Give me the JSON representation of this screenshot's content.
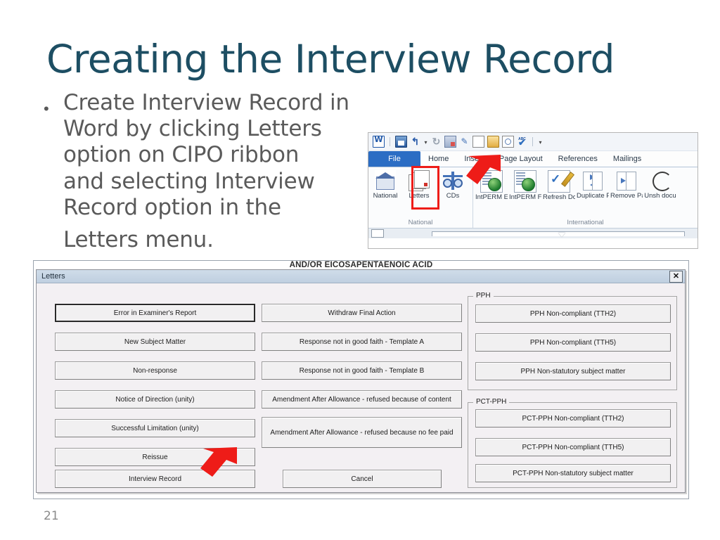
{
  "slide": {
    "title": "Creating the Interview Record",
    "number": "21",
    "bullet": {
      "marker": "•",
      "lines": [
        "Create Interview Record in Word by clicking Letters",
        "option on CIPO ribbon",
        "and selecting Interview",
        "Record option in the",
        "Letters menu."
      ]
    }
  },
  "ribbon_screenshot": {
    "quick_access": [
      {
        "name": "word-logo-icon",
        "label": "W"
      },
      {
        "name": "save-icon",
        "label": "Save"
      },
      {
        "name": "undo-icon",
        "label": "Undo"
      },
      {
        "name": "undo-dropdown-icon",
        "label": "▾"
      },
      {
        "name": "redo-icon",
        "label": "Redo"
      },
      {
        "name": "insert-image-icon",
        "label": "Insert Image"
      },
      {
        "name": "format-painter-icon",
        "label": "Format Painter"
      },
      {
        "name": "new-document-icon",
        "label": "New"
      },
      {
        "name": "open-folder-icon",
        "label": "Open"
      },
      {
        "name": "print-preview-icon",
        "label": "Print Preview"
      },
      {
        "name": "spelling-check-icon",
        "label": "Spelling"
      },
      {
        "name": "customize-qat-icon",
        "label": "▾"
      }
    ],
    "tabs": [
      {
        "label": "File",
        "active": true
      },
      {
        "label": "Home",
        "active": false
      },
      {
        "label": "Insert",
        "active": false
      },
      {
        "label": "Page Layout",
        "active": false
      },
      {
        "label": "References",
        "active": false
      },
      {
        "label": "Mailings",
        "active": false
      }
    ],
    "groups": [
      {
        "label": "National",
        "items": [
          {
            "label": "National",
            "icon": "house-icon",
            "highlighted": false
          },
          {
            "label": "Letters",
            "icon": "stacked-documents-icon",
            "highlighted": true
          },
          {
            "label": "CDs",
            "icon": "balance-scale-icon",
            "highlighted": false
          }
        ]
      },
      {
        "label": "International",
        "items": [
          {
            "label": "IntPERM Eng",
            "icon": "globe-document-icon",
            "highlighted": false
          },
          {
            "label": "IntPERM Fre",
            "icon": "globe-document-icon",
            "highlighted": false
          },
          {
            "label": "Refresh Document",
            "icon": "checkmark-pencil-icon",
            "highlighted": false
          },
          {
            "label": "Duplicate Page",
            "icon": "duplicate-page-icon",
            "highlighted": false
          },
          {
            "label": "Remove Page",
            "icon": "remove-page-icon",
            "highlighted": false
          },
          {
            "label": "Unsh docu",
            "icon": "unshare-document-icon",
            "highlighted": false
          }
        ]
      }
    ],
    "highlight_color": "#ee1c18",
    "arrow_color": "#ee1c18"
  },
  "document_background": {
    "text": "AND/OR EICOSAPENTAENOIC ACID"
  },
  "letters_dialog": {
    "title": "Letters",
    "close_label": "✕",
    "left_column": [
      {
        "label": "Error in Examiner's Report",
        "focused": true
      },
      {
        "label": "New Subject Matter",
        "focused": false
      },
      {
        "label": "Non-response",
        "focused": false
      },
      {
        "label": "Notice of Direction (unity)",
        "focused": false
      },
      {
        "label": "Successful Limitation (unity)",
        "focused": false
      },
      {
        "label": "Reissue",
        "focused": false
      },
      {
        "label": "Interview Record",
        "focused": false
      }
    ],
    "middle_column": [
      {
        "label": "Withdraw Final Action"
      },
      {
        "label": "Response not in good faith - Template A"
      },
      {
        "label": "Response not in good faith - Template B"
      },
      {
        "label": "Amendment After Allowance - refused because of content"
      },
      {
        "label": "Amendment After Allowance - refused because no fee paid"
      }
    ],
    "cancel_label": "Cancel",
    "groups": [
      {
        "legend": "PPH",
        "buttons": [
          {
            "label": "PPH Non-compliant (TTH2)"
          },
          {
            "label": "PPH Non-compliant (TTH5)"
          },
          {
            "label": "PPH Non-statutory subject matter"
          }
        ]
      },
      {
        "legend": "PCT-PPH",
        "buttons": [
          {
            "label": "PCT-PPH Non-compliant (TTH2)"
          },
          {
            "label": "PCT-PPH Non-compliant (TTH5)"
          },
          {
            "label": "PCT-PPH Non-statutory subject matter"
          }
        ]
      }
    ],
    "arrow_color": "#ee1c18"
  },
  "colors": {
    "title": "#1d4e63",
    "body_text": "#5a5a5a",
    "accent_red": "#ee1c18",
    "file_tab_blue": "#2b6dc4"
  }
}
